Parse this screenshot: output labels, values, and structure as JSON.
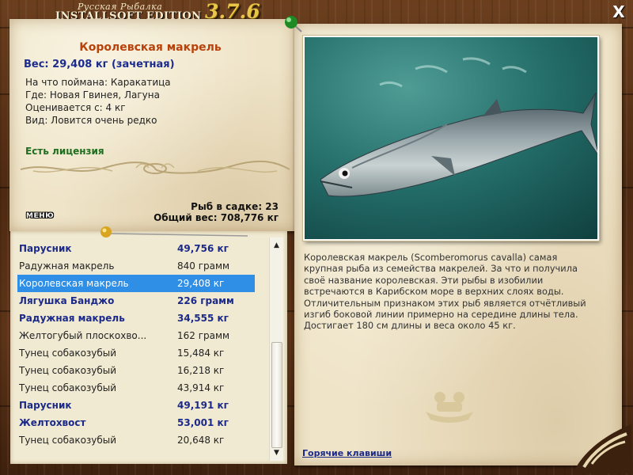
{
  "header": {
    "logo_top": "Русская Рыбалка",
    "logo_bottom": "INSTALLSOFT EDITION",
    "version": "3.7.6",
    "close_label": "X"
  },
  "fish": {
    "name": "Королевская макрель",
    "weight_line": "Вес: 29,408 кг (зачетная)",
    "caught_on": "На что поймана: Каракатица",
    "location": "Где: Новая Гвинея, Лагуна",
    "rated_from": "Оценивается с: 4 кг",
    "rarity": "Вид: Ловится очень редко",
    "license": "Есть лицензия",
    "description": "Королевская макрель (Scomberomorus cavalla) самая крупная рыба из семейства макрелей. За что и получила своё название королевская. Эти рыбы в изобилии встречаются в Карибском море в верхних слоях воды. Отличительным признаком этих рыб является отчётливый изгиб боковой линии примерно на середине длины тела. Достигает 180 см длины и веса около 45 кг."
  },
  "cage": {
    "count_line": "Рыб в садке: 23",
    "total_line": "Общий вес: 708,776 кг"
  },
  "menu_label": "МЕНЮ",
  "hotkeys_label": "Горячие клавиши",
  "fish_list": [
    {
      "name": "Парусник",
      "weight": "49,756 кг",
      "bold": true,
      "selected": false
    },
    {
      "name": "Радужная макрель",
      "weight": "840 грамм",
      "bold": false,
      "selected": false
    },
    {
      "name": "Королевская макрель",
      "weight": "29,408 кг",
      "bold": false,
      "selected": true
    },
    {
      "name": "Лягушка Банджо",
      "weight": "226 грамм",
      "bold": true,
      "selected": false
    },
    {
      "name": "Радужная макрель",
      "weight": "34,555 кг",
      "bold": true,
      "selected": false
    },
    {
      "name": "Желтогубый плоскохво...",
      "weight": "162 грамм",
      "bold": false,
      "selected": false
    },
    {
      "name": "Тунец собакозубый",
      "weight": "15,484 кг",
      "bold": false,
      "selected": false
    },
    {
      "name": "Тунец собакозубый",
      "weight": "16,218 кг",
      "bold": false,
      "selected": false
    },
    {
      "name": "Тунец собакозубый",
      "weight": "43,914 кг",
      "bold": false,
      "selected": false
    },
    {
      "name": "Парусник",
      "weight": "49,191 кг",
      "bold": true,
      "selected": false
    },
    {
      "name": "Желтохвост",
      "weight": "53,001 кг",
      "bold": true,
      "selected": false
    },
    {
      "name": "Тунец собакозубый",
      "weight": "20,648 кг",
      "bold": false,
      "selected": false
    }
  ],
  "colors": {
    "fish_name": "#b8420c",
    "weight_text": "#1b2b8e",
    "license_text": "#1e6e1e",
    "selected_row": "#2f8fe6",
    "version": "#e9c64a"
  },
  "icons": {
    "close": "close-icon",
    "scroll_up": "scroll-up-arrow-icon",
    "scroll_down": "scroll-down-arrow-icon",
    "pin_green": "green-pin-icon",
    "pin_gold": "gold-pin-icon"
  }
}
